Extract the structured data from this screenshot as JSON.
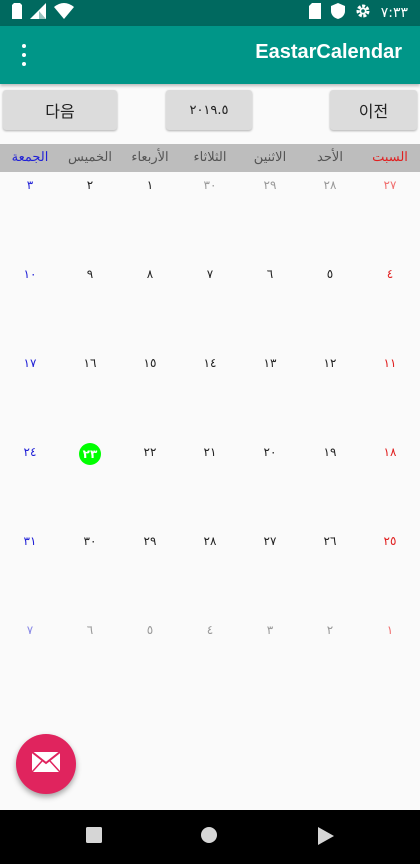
{
  "status_bar": {
    "time": "٧:٣٣",
    "icons": [
      "sim-icon",
      "signal-icon",
      "wifi-icon",
      "sd-card-icon",
      "shield-icon",
      "settings-icon"
    ]
  },
  "app_bar": {
    "title": "EastarCalendar",
    "menu_icon": "overflow-menu-icon"
  },
  "navigation": {
    "next_label": "다음",
    "month_label": "٢٠١٩.٥",
    "prev_label": "이전"
  },
  "weekdays": [
    "الجمعة",
    "الخميس",
    "الأربعاء",
    "الثلاثاء",
    "الاثنين",
    "الأحد",
    "السبت"
  ],
  "weeks": [
    [
      "٣",
      "٢",
      "١",
      "٣٠",
      "٢٩",
      "٢٨",
      "٢٧"
    ],
    [
      "١٠",
      "٩",
      "٨",
      "٧",
      "٦",
      "٥",
      "٤"
    ],
    [
      "١٧",
      "١٦",
      "١٥",
      "١٤",
      "١٣",
      "١٢",
      "١١"
    ],
    [
      "٢٤",
      "٢٣",
      "٢٢",
      "٢١",
      "٢٠",
      "١٩",
      "١٨"
    ],
    [
      "٣١",
      "٣٠",
      "٢٩",
      "٢٨",
      "٢٧",
      "٢٦",
      "٢٥"
    ],
    [
      "٧",
      "٦",
      "٥",
      "٤",
      "٣",
      "٢",
      "١"
    ]
  ],
  "today": "٢٣",
  "fab": {
    "icon": "mail-icon"
  },
  "nav_bar": {
    "icons": [
      "recents-icon",
      "home-icon",
      "back-icon"
    ]
  },
  "colors": {
    "status_bar": "#00695f",
    "app_bar": "#009688",
    "friday": "#1f1fd6",
    "saturday": "#e02020",
    "today": "#00ff00",
    "fab": "#e0245e"
  }
}
